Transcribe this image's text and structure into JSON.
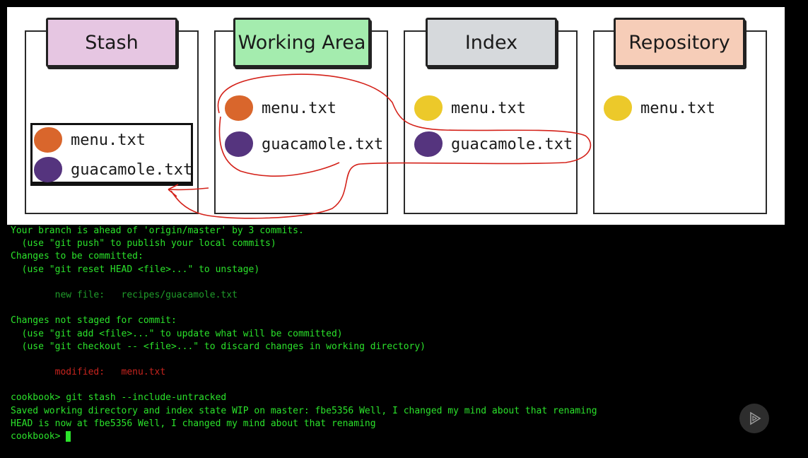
{
  "diagram": {
    "stash": {
      "title": "Stash",
      "color": "#e6c6e2",
      "files": [
        {
          "name": "menu.txt",
          "blob": "#d9662c"
        },
        {
          "name": "guacamole.txt",
          "blob": "#55347e"
        }
      ]
    },
    "working": {
      "title": "Working Area",
      "color": "#a4ecae",
      "files": [
        {
          "name": "menu.txt",
          "blob": "#d9662c"
        },
        {
          "name": "guacamole.txt",
          "blob": "#55347e"
        }
      ]
    },
    "index": {
      "title": "Index",
      "color": "#d6d9dc",
      "files": [
        {
          "name": "menu.txt",
          "blob": "#ecc92a"
        },
        {
          "name": "guacamole.txt",
          "blob": "#55347e"
        }
      ]
    },
    "repository": {
      "title": "Repository",
      "color": "#f6cdb8",
      "files": [
        {
          "name": "menu.txt",
          "blob": "#ecc92a"
        }
      ]
    }
  },
  "terminal": {
    "lines": [
      {
        "text": "Your branch is ahead of 'origin/master' by 3 commits.",
        "color": "green"
      },
      {
        "text": "  (use \"git push\" to publish your local commits)",
        "color": "green"
      },
      {
        "text": "Changes to be committed:",
        "color": "green"
      },
      {
        "text": "  (use \"git reset HEAD <file>...\" to unstage)",
        "color": "green"
      },
      {
        "text": "",
        "color": "green"
      },
      {
        "text": "        new file:   recipes/guacamole.txt",
        "color": "darkgreen"
      },
      {
        "text": "",
        "color": "green"
      },
      {
        "text": "Changes not staged for commit:",
        "color": "green"
      },
      {
        "text": "  (use \"git add <file>...\" to update what will be committed)",
        "color": "green"
      },
      {
        "text": "  (use \"git checkout -- <file>...\" to discard changes in working directory)",
        "color": "green"
      },
      {
        "text": "",
        "color": "green"
      },
      {
        "text": "        modified:   menu.txt",
        "color": "red"
      },
      {
        "text": "",
        "color": "green"
      },
      {
        "text": "cookbook> git stash --include-untracked",
        "color": "green"
      },
      {
        "text": "Saved working directory and index state WIP on master: fbe5356 Well, I changed my mind about that renaming",
        "color": "green"
      },
      {
        "text": "HEAD is now at fbe5356 Well, I changed my mind about that renaming",
        "color": "green"
      }
    ],
    "prompt": "cookbook> ",
    "colors": {
      "green": "#2be22b",
      "darkgreen": "#1f9c2a",
      "red": "#c8241e"
    }
  },
  "player": {
    "icon": "play-icon"
  },
  "annotation_color": "#d4221a"
}
